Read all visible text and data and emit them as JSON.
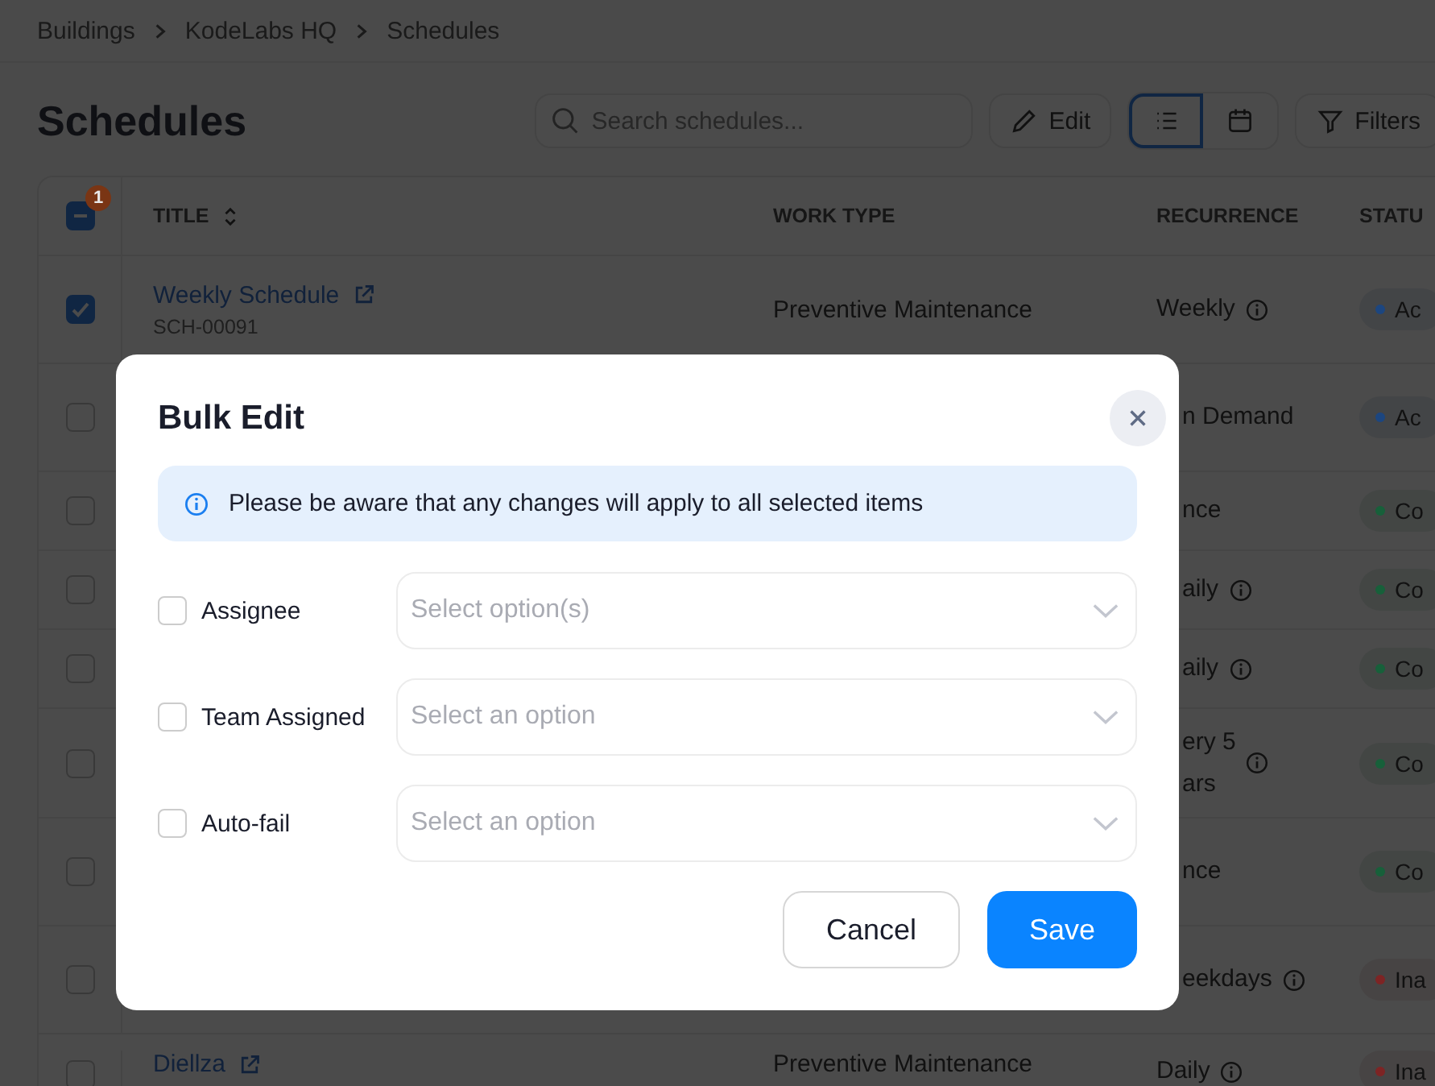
{
  "breadcrumbs": [
    "Buildings",
    "KodeLabs HQ",
    "Schedules"
  ],
  "page_title": "Schedules",
  "search": {
    "placeholder": "Search schedules..."
  },
  "toolbar": {
    "edit_label": "Edit",
    "views": [
      {
        "kind": "list",
        "selected": true
      },
      {
        "kind": "calendar",
        "selected": false
      }
    ],
    "filters_label": "Filters"
  },
  "table": {
    "select_all": {
      "partial": true
    },
    "selected_count": "1",
    "columns": [
      "TITLE",
      "WORK TYPE",
      "RECURRENCE",
      "STATU"
    ],
    "rows": [
      {
        "checked": true,
        "title": "Weekly Schedule",
        "code": "SCH-00091",
        "work_type": "Preventive Maintenance",
        "recurrence": [
          "Weekly"
        ],
        "recurrence_info": true,
        "status": "Ac",
        "color": "#1c4680"
      },
      {
        "checked": false,
        "recurrence": [
          "n Demand"
        ],
        "recurrence_info": false,
        "status": "Ac",
        "color": "#1c4680"
      },
      {
        "checked": false,
        "recurrence": [
          "nce"
        ],
        "recurrence_info": false,
        "status": "Co",
        "color": "#17603a"
      },
      {
        "checked": false,
        "recurrence": [
          "aily"
        ],
        "recurrence_info": true,
        "status": "Co",
        "color": "#17603a"
      },
      {
        "checked": false,
        "recurrence": [
          "aily"
        ],
        "recurrence_info": true,
        "status": "Co",
        "color": "#17603a"
      },
      {
        "checked": false,
        "recurrence": [
          "ery 5",
          "ars"
        ],
        "recurrence_info": true,
        "status": "Co",
        "color": "#17603a"
      },
      {
        "checked": false,
        "recurrence": [
          "nce"
        ],
        "recurrence_info": false,
        "status": "Co",
        "color": "#17603a"
      },
      {
        "checked": false,
        "recurrence": [
          "eekdays"
        ],
        "recurrence_info": true,
        "status": "Ina",
        "color": "#7e2424"
      },
      {
        "checked": false,
        "title": "Diellza",
        "work_type": "Preventive Maintenance",
        "recurrence": [
          "Daily"
        ],
        "recurrence_info": true,
        "status": "Ina",
        "color": "#7e2424"
      }
    ]
  },
  "dialog": {
    "title": "Bulk Edit",
    "notice": "Please be aware that any changes will apply to all selected items",
    "fields": [
      {
        "label": "Assignee",
        "checked": false,
        "placeholder": "Select option(s)"
      },
      {
        "label": "Team Assigned",
        "checked": false,
        "placeholder": "Select an option"
      },
      {
        "label": "Auto-fail",
        "checked": false,
        "placeholder": "Select an option"
      }
    ],
    "buttons": [
      {
        "label": "Cancel",
        "kind": "secondary"
      },
      {
        "label": "Save",
        "kind": "primary"
      }
    ]
  }
}
